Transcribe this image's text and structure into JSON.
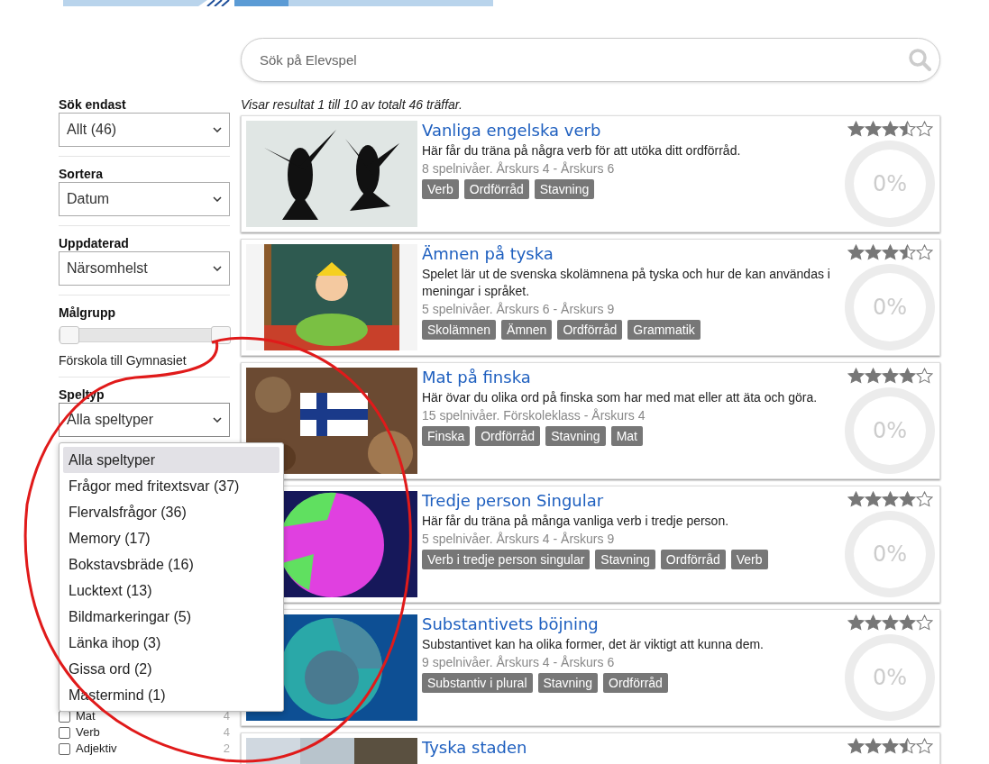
{
  "search": {
    "placeholder": "Sök på Elevspel"
  },
  "filters": [
    {
      "label": "Sök endast",
      "value": "Allt (46)"
    },
    {
      "label": "Sortera",
      "value": "Datum"
    },
    {
      "label": "Uppdaterad",
      "value": "Närsomhelst"
    }
  ],
  "age_filter": {
    "label": "Målgrupp",
    "handles": [
      {
        "level": 0
      },
      {
        "level": 1
      }
    ],
    "reading": "Förskola till Gymnasiet"
  },
  "game_type": {
    "label": "Speltyp",
    "value": "Alla speltyper",
    "expanded": true,
    "options": [
      {
        "label": "Alla speltyper",
        "selected": true
      },
      {
        "label": "Frågor med fritextsvar (37)",
        "selected": false
      },
      {
        "label": "Flervalsfrågor (36)",
        "selected": false
      },
      {
        "label": "Memory (17)",
        "selected": false
      },
      {
        "label": "Bokstavsbräde (16)",
        "selected": false
      },
      {
        "label": "Lucktext (13)",
        "selected": false
      },
      {
        "label": "Bildmarkeringar (5)",
        "selected": false
      },
      {
        "label": "Länka ihop (3)",
        "selected": false
      },
      {
        "label": "Gissa ord (2)",
        "selected": false
      },
      {
        "label": "Mastermind (1)",
        "selected": false
      }
    ]
  },
  "tag_filters": [
    {
      "label": "Mat",
      "count": "4",
      "checked": false
    },
    {
      "label": "Verb",
      "count": "4",
      "checked": false
    },
    {
      "label": "Adjektiv",
      "count": "2",
      "checked": false
    }
  ],
  "results_summary": "Visar resultat 1 till 10 av totalt 46 träffar.",
  "results": [
    {
      "title": "Vanliga engelska verb",
      "description": "Här får du träna på några verb för att utöka ditt ordförråd.",
      "meta": "8 spelnivåer. Årskurs 4 - Årskurs 6",
      "tags": [
        "Verb",
        "Ordförråd",
        "Stavning"
      ],
      "stars": 3.5,
      "progress": "0%"
    },
    {
      "title": "Ämnen på tyska",
      "description": "Spelet lär ut de svenska skolämnena på tyska och hur de kan användas i meningar i språket.",
      "meta": "5 spelnivåer. Årskurs 6 - Årskurs 9",
      "tags": [
        "Skolämnen",
        "Ämnen",
        "Ordförråd",
        "Grammatik"
      ],
      "stars": 3.5,
      "progress": "0%"
    },
    {
      "title": "Mat på finska",
      "description": "Här övar du olika ord på finska som har med mat eller att äta och göra.",
      "meta": "15 spelnivåer. Förskoleklass - Årskurs 4",
      "tags": [
        "Finska",
        "Ordförråd",
        "Stavning",
        "Mat"
      ],
      "stars": 4,
      "progress": "0%"
    },
    {
      "title": "Tredje person Singular",
      "description": "Här får du träna på många vanliga verb i tredje person.",
      "meta": "5 spelnivåer. Årskurs 4 - Årskurs 9",
      "tags": [
        "Verb i tredje person singular",
        "Stavning",
        "Ordförråd",
        "Verb"
      ],
      "stars": 4,
      "progress": "0%"
    },
    {
      "title": "Substantivets böjning",
      "description": "Substantivet kan ha olika former, det är viktigt att kunna dem.",
      "meta": "9 spelnivåer. Årskurs 4 - Årskurs 6",
      "tags": [
        "Substantiv i plural",
        "Stavning",
        "Ordförråd"
      ],
      "stars": 4,
      "progress": "0%"
    },
    {
      "title": "Tyska staden",
      "stars": 3.5
    }
  ]
}
